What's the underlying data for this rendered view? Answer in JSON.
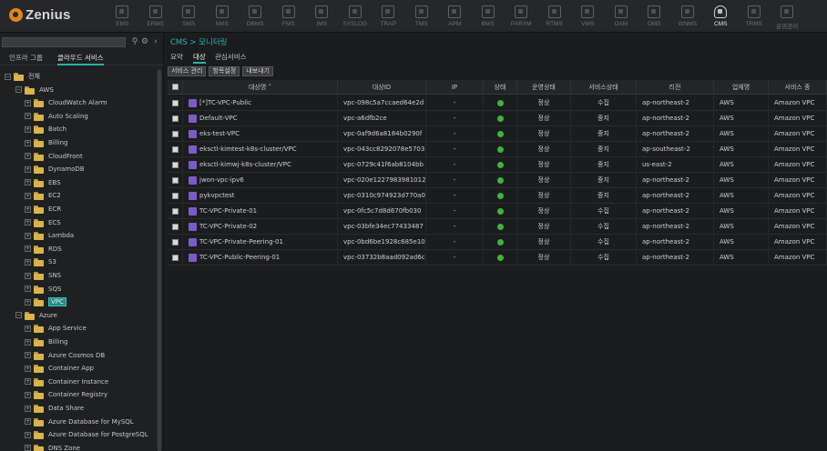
{
  "app": {
    "logo_text": "Zenius",
    "nav": [
      {
        "label": "EMS",
        "icon": "monitor-icon"
      },
      {
        "label": "ERMS",
        "icon": "network-icon"
      },
      {
        "label": "SMS",
        "icon": "server-icon"
      },
      {
        "label": "NMS",
        "icon": "topology-icon"
      },
      {
        "label": "DBMS",
        "icon": "database-icon"
      },
      {
        "label": "FMS",
        "icon": "facility-icon"
      },
      {
        "label": "IMS",
        "icon": "globe-icon"
      },
      {
        "label": "SYSLOG",
        "icon": "log-icon"
      },
      {
        "label": "TRAP",
        "icon": "trap-icon"
      },
      {
        "label": "TMS",
        "icon": "terminal-icon"
      },
      {
        "label": "APM",
        "icon": "apm-icon"
      },
      {
        "label": "BMS",
        "icon": "bms-icon"
      },
      {
        "label": "PARXM",
        "icon": "parxm-icon"
      },
      {
        "label": "RTMS",
        "icon": "rtms-icon"
      },
      {
        "label": "VMS",
        "icon": "vms-icon"
      },
      {
        "label": "OAM",
        "icon": "oam-icon"
      },
      {
        "label": "DMS",
        "icon": "dms-icon"
      },
      {
        "label": "WNMS",
        "icon": "wireless-icon"
      },
      {
        "label": "CMS",
        "icon": "cloud-icon",
        "active": true
      },
      {
        "label": "TRMS",
        "icon": "trms-icon"
      },
      {
        "label": "운영관리",
        "icon": "settings-icon"
      }
    ]
  },
  "left": {
    "search": {
      "value": "",
      "placeholder": ""
    },
    "tools": {
      "search_icon": "search-icon",
      "settings_icon": "gear-icon",
      "collapse_icon": "chevron-left-icon"
    },
    "tabs": [
      {
        "label": "인프라 그룹"
      },
      {
        "label": "클라우드 서비스",
        "active": true
      }
    ],
    "tree": [
      {
        "label": "전체",
        "level": 0,
        "expander": "−"
      },
      {
        "label": "AWS",
        "level": 1,
        "expander": "−"
      },
      {
        "label": "CloudWatch Alarm",
        "level": 2,
        "expander": "+"
      },
      {
        "label": "Auto Scaling",
        "level": 2,
        "expander": "+"
      },
      {
        "label": "Batch",
        "level": 2,
        "expander": "+"
      },
      {
        "label": "Billing",
        "level": 2,
        "expander": "+"
      },
      {
        "label": "CloudFront",
        "level": 2,
        "expander": "+"
      },
      {
        "label": "DynamoDB",
        "level": 2,
        "expander": "+"
      },
      {
        "label": "EBS",
        "level": 2,
        "expander": "+"
      },
      {
        "label": "EC2",
        "level": 2,
        "expander": "+"
      },
      {
        "label": "ECR",
        "level": 2,
        "expander": "+"
      },
      {
        "label": "ECS",
        "level": 2,
        "expander": "+"
      },
      {
        "label": "Lambda",
        "level": 2,
        "expander": "+"
      },
      {
        "label": "RDS",
        "level": 2,
        "expander": "+"
      },
      {
        "label": "S3",
        "level": 2,
        "expander": "+"
      },
      {
        "label": "SNS",
        "level": 2,
        "expander": "+"
      },
      {
        "label": "SQS",
        "level": 2,
        "expander": "+"
      },
      {
        "label": "VPC",
        "level": 2,
        "expander": "+",
        "selected": true
      },
      {
        "label": "Azure",
        "level": 1,
        "expander": "−"
      },
      {
        "label": "App Service",
        "level": 2,
        "expander": "+"
      },
      {
        "label": "Billing",
        "level": 2,
        "expander": "+"
      },
      {
        "label": "Azure Cosmos DB",
        "level": 2,
        "expander": "+"
      },
      {
        "label": "Container App",
        "level": 2,
        "expander": "+"
      },
      {
        "label": "Container Instance",
        "level": 2,
        "expander": "+"
      },
      {
        "label": "Container Registry",
        "level": 2,
        "expander": "+"
      },
      {
        "label": "Data Share",
        "level": 2,
        "expander": "+"
      },
      {
        "label": "Azure Database for MySQL",
        "level": 2,
        "expander": "+"
      },
      {
        "label": "Azure Database for PostgreSQL",
        "level": 2,
        "expander": "+"
      },
      {
        "label": "DNS Zone",
        "level": 2,
        "expander": "+"
      }
    ]
  },
  "main": {
    "breadcrumb": "CMS > 모니터링",
    "tabs": [
      {
        "label": "요약"
      },
      {
        "label": "대상",
        "active": true
      },
      {
        "label": "관심서비스"
      }
    ],
    "actions": [
      {
        "label": "서비스 관리"
      },
      {
        "label": "항목설정"
      },
      {
        "label": "내보내기"
      }
    ],
    "columns": [
      "",
      "대상명 ˄",
      "대상ID",
      "IP",
      "상태",
      "운영상태",
      "서비스상태",
      "리전",
      "업체명",
      "서비스 종"
    ],
    "rows": [
      {
        "name": "[*]TC-VPC-Public",
        "id": "vpc-098c5a7ccaed64e2d",
        "ip": "-",
        "op": "정상",
        "svc": "수집",
        "region": "ap-northeast-2",
        "vendor": "AWS",
        "type": "Amazon VPC"
      },
      {
        "name": "Default-VPC",
        "id": "vpc-a6dfb2ce",
        "ip": "-",
        "op": "정상",
        "svc": "중지",
        "region": "ap-northeast-2",
        "vendor": "AWS",
        "type": "Amazon VPC"
      },
      {
        "name": "eks-test-VPC",
        "id": "vpc-0af9d6a8184b0290f",
        "ip": "-",
        "op": "정상",
        "svc": "중지",
        "region": "ap-northeast-2",
        "vendor": "AWS",
        "type": "Amazon VPC"
      },
      {
        "name": "eksctl-kimtest-k8s-cluster/VPC",
        "id": "vpc-043cc8292078e5703",
        "ip": "-",
        "op": "정상",
        "svc": "중지",
        "region": "ap-southeast-2",
        "vendor": "AWS",
        "type": "Amazon VPC"
      },
      {
        "name": "eksctl-kimwj-k8s-cluster/VPC",
        "id": "vpc-0729c41f6ab8104bb",
        "ip": "-",
        "op": "정상",
        "svc": "중지",
        "region": "us-east-2",
        "vendor": "AWS",
        "type": "Amazon VPC"
      },
      {
        "name": "jwon-vpc-ipv6",
        "id": "vpc-020e1227983981012",
        "ip": "-",
        "op": "정상",
        "svc": "중지",
        "region": "ap-northeast-2",
        "vendor": "AWS",
        "type": "Amazon VPC"
      },
      {
        "name": "pykvpctest",
        "id": "vpc-0310c974923d770a0",
        "ip": "-",
        "op": "정상",
        "svc": "중지",
        "region": "ap-northeast-2",
        "vendor": "AWS",
        "type": "Amazon VPC"
      },
      {
        "name": "TC-VPC-Private-01",
        "id": "vpc-0fc5c7d8d670fb030",
        "ip": "-",
        "op": "정상",
        "svc": "수집",
        "region": "ap-northeast-2",
        "vendor": "AWS",
        "type": "Amazon VPC"
      },
      {
        "name": "TC-VPC-Private-02",
        "id": "vpc-03bfe34ec77433487",
        "ip": "-",
        "op": "정상",
        "svc": "수집",
        "region": "ap-northeast-2",
        "vendor": "AWS",
        "type": "Amazon VPC"
      },
      {
        "name": "TC-VPC-Private-Peering-01",
        "id": "vpc-0bd6be1928c685e10",
        "ip": "-",
        "op": "정상",
        "svc": "수집",
        "region": "ap-northeast-2",
        "vendor": "AWS",
        "type": "Amazon VPC"
      },
      {
        "name": "TC-VPC-Public-Peering-01",
        "id": "vpc-03732b8aad092ad6c",
        "ip": "-",
        "op": "정상",
        "svc": "수집",
        "region": "ap-northeast-2",
        "vendor": "AWS",
        "type": "Amazon VPC"
      }
    ]
  },
  "colors": {
    "accent": "#27b3a8",
    "status_ok": "#3fb23f",
    "service_icon": "#7b5cc7",
    "folder": "#d8b44a"
  }
}
